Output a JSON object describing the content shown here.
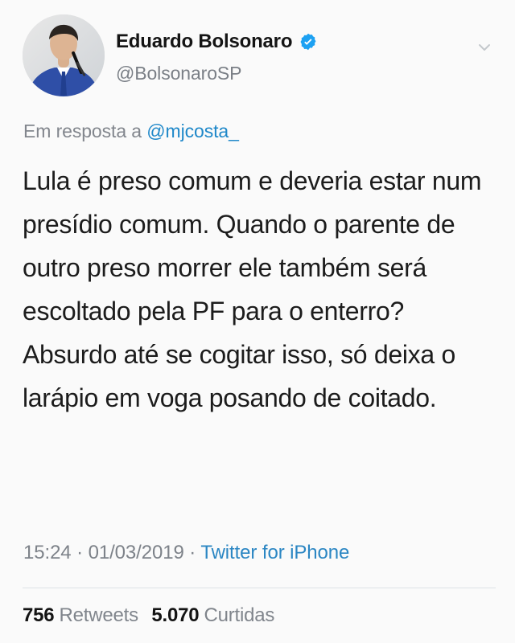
{
  "header": {
    "display_name": "Eduardo Bolsonaro",
    "handle": "@BolsonaroSP",
    "verified_icon": "verified-badge-icon",
    "menu_icon": "chevron-down-icon"
  },
  "reply": {
    "prefix": "Em resposta a",
    "mention": "@mjcosta_"
  },
  "tweet": {
    "text": "Lula é preso comum e deveria estar num presídio comum. Quando o parente de outro preso morrer ele também será escoltado pela PF para o enterro? Absurdo até se cogitar isso, só deixa o larápio em voga posando de coitado."
  },
  "meta": {
    "time": "15:24",
    "separator_1": " · ",
    "date": "01/03/2019",
    "separator_2": " · ",
    "source": "Twitter for iPhone"
  },
  "stats": {
    "retweets_value": "756",
    "retweets_label": "Retweets",
    "likes_value": "5.070",
    "likes_label": "Curtidas"
  },
  "colors": {
    "background": "#fafafa",
    "link_blue": "#1f88c9",
    "muted_gray": "#7d8289",
    "verified_blue": "#1da1f2"
  }
}
